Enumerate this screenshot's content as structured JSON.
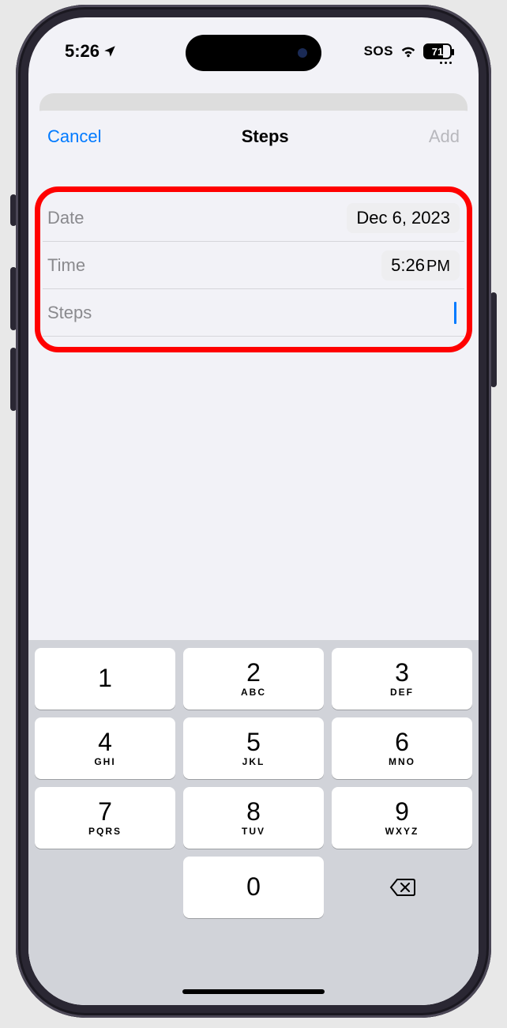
{
  "status": {
    "time": "5:26",
    "sos": "SOS",
    "battery_pct": "71"
  },
  "nav": {
    "cancel": "Cancel",
    "title": "Steps",
    "add": "Add"
  },
  "form": {
    "date_label": "Date",
    "date_value": "Dec 6, 2023",
    "time_label": "Time",
    "time_value": "5:26",
    "time_ampm": "PM",
    "steps_label": "Steps"
  },
  "keypad": {
    "k1": {
      "num": "1",
      "sub": ""
    },
    "k2": {
      "num": "2",
      "sub": "ABC"
    },
    "k3": {
      "num": "3",
      "sub": "DEF"
    },
    "k4": {
      "num": "4",
      "sub": "GHI"
    },
    "k5": {
      "num": "5",
      "sub": "JKL"
    },
    "k6": {
      "num": "6",
      "sub": "MNO"
    },
    "k7": {
      "num": "7",
      "sub": "PQRS"
    },
    "k8": {
      "num": "8",
      "sub": "TUV"
    },
    "k9": {
      "num": "9",
      "sub": "WXYZ"
    },
    "k0": {
      "num": "0",
      "sub": ""
    }
  }
}
